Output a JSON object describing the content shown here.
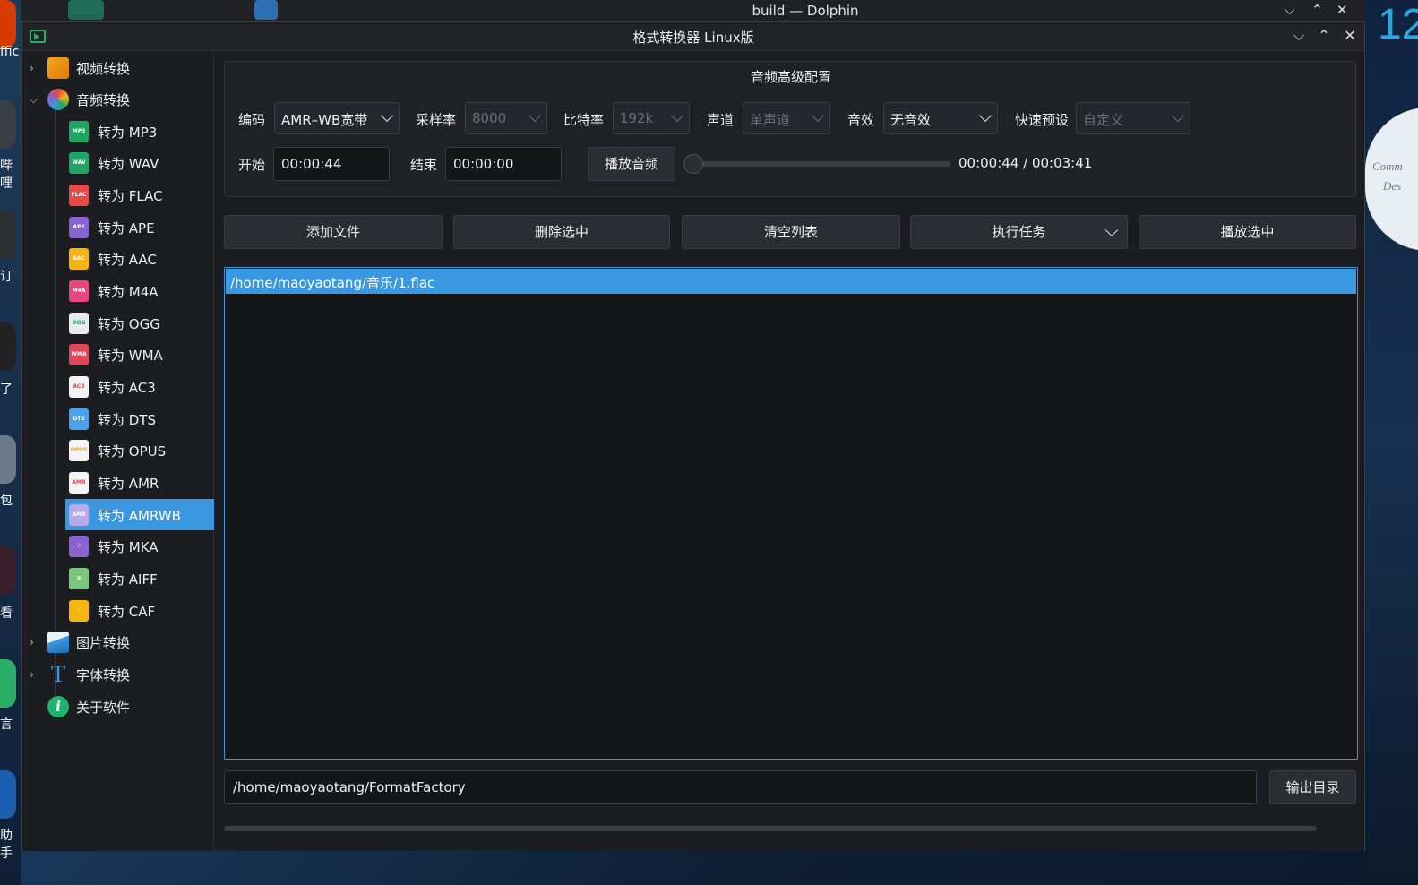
{
  "desktop": {
    "clock_digits": "12",
    "left_labels": [
      "ffic",
      "哔哩",
      "订",
      "了",
      "包",
      "看",
      "言",
      "助手"
    ],
    "clock_text": [
      "Comm",
      "Des"
    ]
  },
  "back_window": {
    "title": "build — Dolphin"
  },
  "window": {
    "title": "格式转换器 Linux版"
  },
  "sidebar": {
    "items": [
      {
        "label": "视频转换",
        "icon": "video-convert-icon",
        "expanded": false
      },
      {
        "label": "音频转换",
        "icon": "audio-convert-icon",
        "expanded": true
      },
      {
        "label": "图片转换",
        "icon": "image-convert-icon",
        "expanded": false
      },
      {
        "label": "字体转换",
        "icon": "font-convert-icon",
        "expanded": false
      },
      {
        "label": "关于软件",
        "icon": "info-icon"
      }
    ],
    "audio_children": [
      {
        "label": "转为 MP3",
        "tag": "MP3",
        "color": "#1fa463"
      },
      {
        "label": "转为 WAV",
        "tag": "WAV",
        "color": "#1fa463"
      },
      {
        "label": "转为 FLAC",
        "tag": "FLAC",
        "color": "#e84a4a"
      },
      {
        "label": "转为 APE",
        "tag": "APE",
        "color": "#8a63d2"
      },
      {
        "label": "转为 AAC",
        "tag": "AAC",
        "color": "#f5b40f"
      },
      {
        "label": "转为 M4A",
        "tag": "M4A",
        "color": "#e8467c"
      },
      {
        "label": "转为 OGG",
        "tag": "OGG",
        "color": "#e9ecef"
      },
      {
        "label": "转为 WMA",
        "tag": "WMA",
        "color": "#e0465a"
      },
      {
        "label": "转为 AC3",
        "tag": "AC3",
        "color": "#f3f3f3"
      },
      {
        "label": "转为 DTS",
        "tag": "DTS",
        "color": "#4aa3e8"
      },
      {
        "label": "转为 OPUS",
        "tag": "OPUS",
        "color": "#f3f3f3"
      },
      {
        "label": "转为 AMR",
        "tag": "AMR",
        "color": "#f3f3f3"
      },
      {
        "label": "转为 AMRWB",
        "tag": "AMR",
        "color": "#b9a9e6"
      },
      {
        "label": "转为 MKA",
        "tag": "",
        "color": "#8a63d2"
      },
      {
        "label": "转为 AIFF",
        "tag": "",
        "color": "#7bc67e"
      },
      {
        "label": "转为 CAF",
        "tag": "",
        "color": "#f5b40f"
      }
    ],
    "selected_label": "转为 AMRWB"
  },
  "settings": {
    "group_title": "音频高级配置",
    "codec_label": "编码",
    "codec_value": "AMR–WB宽带",
    "samplerate_label": "采样率",
    "samplerate_value": "8000",
    "bitrate_label": "比特率",
    "bitrate_value": "192k",
    "channel_label": "声道",
    "channel_value": "单声道",
    "effect_label": "音效",
    "effect_value": "无音效",
    "preset_label": "快速预设",
    "preset_value": "自定义",
    "start_label": "开始",
    "start_value": "00:00:44",
    "end_label": "结束",
    "end_value": "00:00:00",
    "play_audio_label": "播放音频",
    "time_display": "00:00:44 / 00:03:41",
    "slider_fraction": 0.0
  },
  "toolbar": {
    "add_file": "添加文件",
    "delete_selected": "删除选中",
    "clear_list": "清空列表",
    "execute_task": "执行任务",
    "play_selected": "播放选中"
  },
  "file_list": [
    "/home/maoyaotang/音乐/1.flac"
  ],
  "output": {
    "path": "/home/maoyaotang/FormatFactory",
    "button_label": "输出目录"
  }
}
